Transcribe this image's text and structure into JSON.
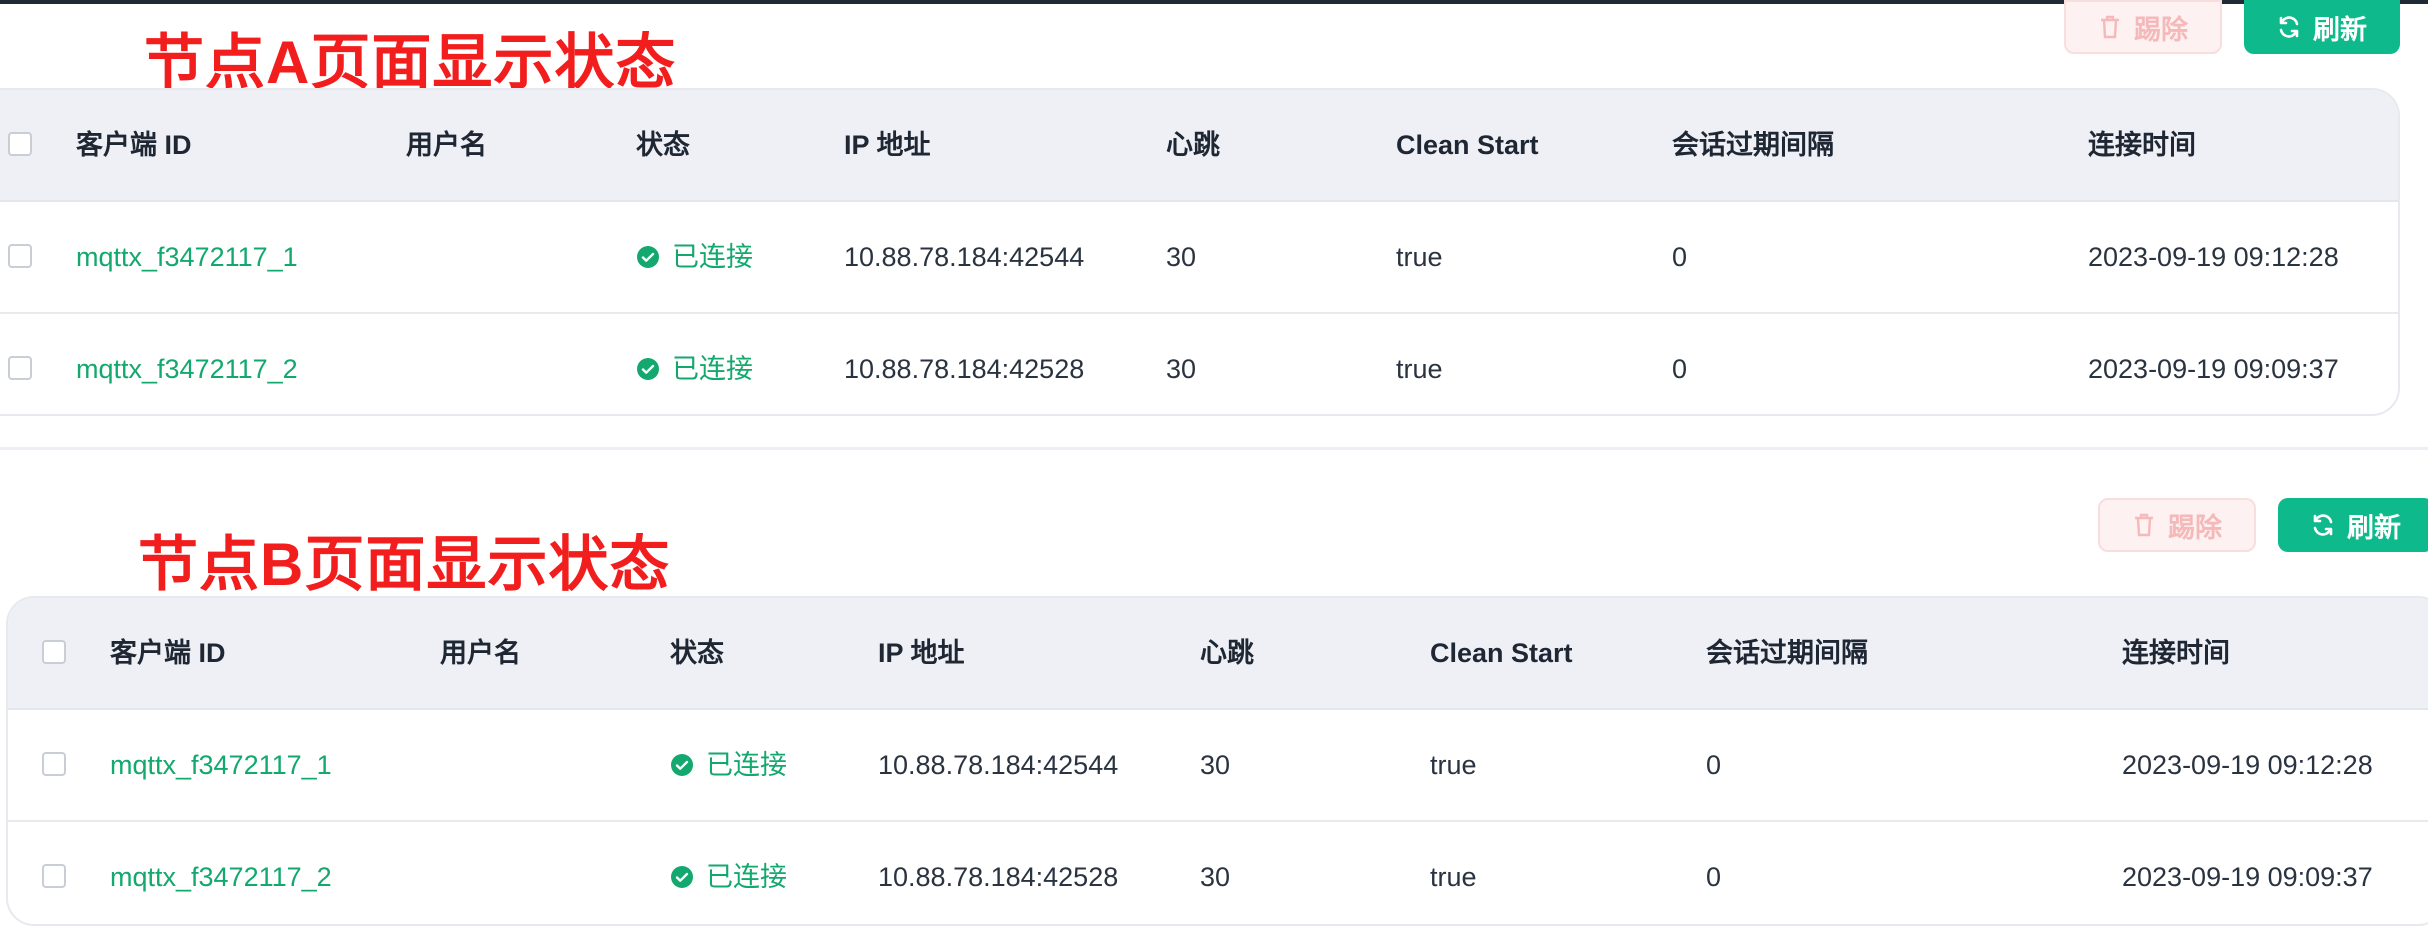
{
  "colors": {
    "accent": "#0eb98c",
    "link": "#13a86e",
    "annotation": "#f21d1d",
    "danger_disabled": "#f5b9b9"
  },
  "toolbar": {
    "kick_label": "踢除",
    "refresh_label": "刷新",
    "kick_icon": "trash-icon",
    "refresh_icon": "refresh-icon"
  },
  "panels": [
    {
      "annotation": "节点A页面显示状态",
      "columns": [
        "客户端 ID",
        "用户名",
        "状态",
        "IP 地址",
        "心跳",
        "Clean Start",
        "会话过期间隔",
        "连接时间"
      ],
      "rows": [
        {
          "client_id": "mqttx_f3472117_1",
          "username": "",
          "status": "已连接",
          "ip": "10.88.78.184:42544",
          "keepalive": "30",
          "clean_start": "true",
          "expiry": "0",
          "connected_at": "2023-09-19 09:12:28"
        },
        {
          "client_id": "mqttx_f3472117_2",
          "username": "",
          "status": "已连接",
          "ip": "10.88.78.184:42528",
          "keepalive": "30",
          "clean_start": "true",
          "expiry": "0",
          "connected_at": "2023-09-19 09:09:37"
        }
      ]
    },
    {
      "annotation": "节点B页面显示状态",
      "columns": [
        "客户端 ID",
        "用户名",
        "状态",
        "IP 地址",
        "心跳",
        "Clean Start",
        "会话过期间隔",
        "连接时间"
      ],
      "rows": [
        {
          "client_id": "mqttx_f3472117_1",
          "username": "",
          "status": "已连接",
          "ip": "10.88.78.184:42544",
          "keepalive": "30",
          "clean_start": "true",
          "expiry": "0",
          "connected_at": "2023-09-19 09:12:28"
        },
        {
          "client_id": "mqttx_f3472117_2",
          "username": "",
          "status": "已连接",
          "ip": "10.88.78.184:42528",
          "keepalive": "30",
          "clean_start": "true",
          "expiry": "0",
          "connected_at": "2023-09-19 09:09:37"
        }
      ]
    }
  ]
}
